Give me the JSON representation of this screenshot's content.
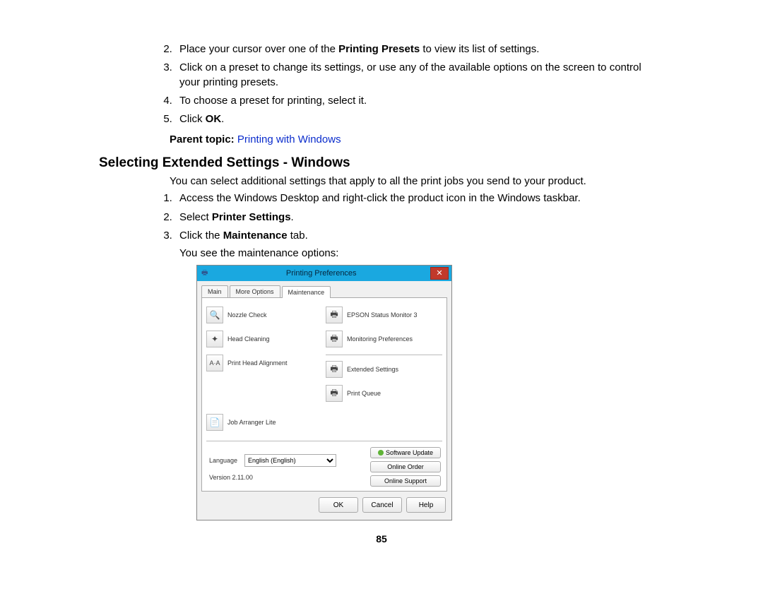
{
  "page_number": "85",
  "first_list": {
    "start": 2,
    "items": [
      {
        "pre": "Place your cursor over one of the ",
        "bold": "Printing Presets",
        "post": " to view its list of settings."
      },
      {
        "pre": "Click on a preset to change its settings, or use any of the available options on the screen to control your printing presets.",
        "bold": "",
        "post": ""
      },
      {
        "pre": "To choose a preset for printing, select it.",
        "bold": "",
        "post": ""
      },
      {
        "pre": "Click ",
        "bold": "OK",
        "post": "."
      }
    ]
  },
  "parent_topic": {
    "label": "Parent topic: ",
    "link": "Printing with Windows"
  },
  "heading": "Selecting Extended Settings - Windows",
  "intro": "You can select additional settings that apply to all the print jobs you send to your product.",
  "second_list": {
    "items": [
      {
        "pre": "Access the Windows Desktop and right-click the product icon in the Windows taskbar.",
        "bold": "",
        "post": ""
      },
      {
        "pre": "Select ",
        "bold": "Printer Settings",
        "post": "."
      },
      {
        "pre": "Click the ",
        "bold": "Maintenance",
        "post": " tab."
      }
    ]
  },
  "subline": "You see the maintenance options:",
  "dialog": {
    "title": "Printing Preferences",
    "tabs": [
      "Main",
      "More Options",
      "Maintenance"
    ],
    "active_tab": 2,
    "left_items": [
      {
        "icon": "🔍",
        "label": "Nozzle Check"
      },
      {
        "icon": "✦",
        "label": "Head Cleaning"
      },
      {
        "icon": "A·A",
        "label": "Print Head Alignment"
      }
    ],
    "right_items_top": [
      {
        "icon": "🖶",
        "label": "EPSON Status Monitor 3"
      },
      {
        "icon": "🖶",
        "label": "Monitoring Preferences"
      }
    ],
    "right_items_mid": [
      {
        "icon": "🖶",
        "label": "Extended Settings"
      },
      {
        "icon": "🖶",
        "label": "Print Queue"
      }
    ],
    "left_bottom": [
      {
        "icon": "📄",
        "label": "Job Arranger Lite"
      }
    ],
    "language_label": "Language",
    "language_value": "English (English)",
    "side_buttons": [
      "Software Update",
      "Online Order",
      "Online Support"
    ],
    "version": "Version 2.11.00",
    "footer_buttons": [
      "OK",
      "Cancel",
      "Help"
    ]
  }
}
